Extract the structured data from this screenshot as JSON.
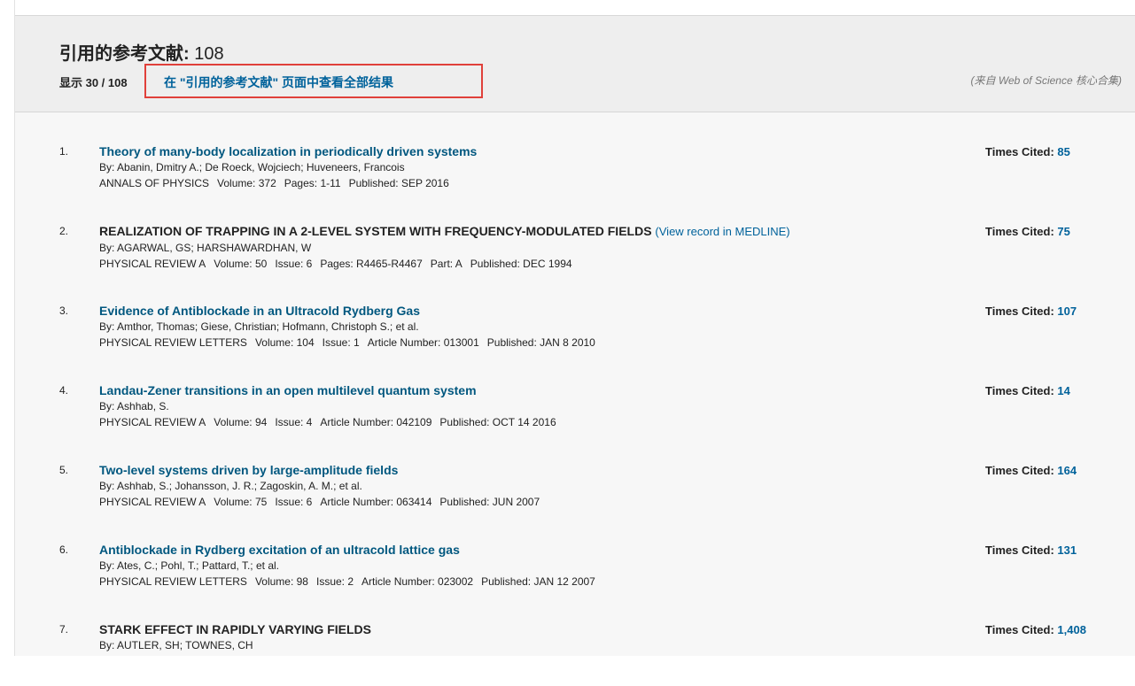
{
  "header": {
    "title": "引用的参考文献",
    "title_count": "108",
    "showing": "显示 30 / 108",
    "view_all_link": "在 \"引用的参考文献\" 页面中查看全部结果",
    "source_note": "(来自 Web of Science 核心合集)"
  },
  "labels": {
    "times_cited": "Times Cited:"
  },
  "records": [
    {
      "num": "1.",
      "title": "Theory of many-body localization in periodically driven systems",
      "authors": "By: Abanin, Dmitry A.; De Roeck, Wojciech; Huveneers, Francois",
      "journal": "ANNALS OF PHYSICS",
      "volume": "Volume: 372",
      "issue": "",
      "pages_or_article": "Pages: 1-11",
      "part": "",
      "published": "Published:  SEP 2016",
      "times_cited": "85"
    },
    {
      "num": "2.",
      "title": "REALIZATION OF TRAPPING IN A 2-LEVEL SYSTEM WITH FREQUENCY-MODULATED FIELDS",
      "medline": "(View record in MEDLINE)",
      "authors": "By: AGARWAL, GS; HARSHAWARDHAN, W",
      "journal": "PHYSICAL REVIEW A",
      "volume": "Volume: 50",
      "issue": "Issue: 6",
      "pages_or_article": "Pages:  R4465-R4467",
      "part": "Part:  A",
      "published": "Published:  DEC 1994",
      "times_cited": "75"
    },
    {
      "num": "3.",
      "title": "Evidence of Antiblockade in an Ultracold Rydberg Gas",
      "authors": "By: Amthor, Thomas; Giese, Christian; Hofmann, Christoph S.; et al.",
      "journal": "PHYSICAL REVIEW LETTERS",
      "volume": "Volume: 104",
      "issue": "Issue: 1",
      "pages_or_article": "Article Number: 013001",
      "part": "",
      "published": "Published:  JAN 8 2010",
      "times_cited": "107"
    },
    {
      "num": "4.",
      "title": "Landau-Zener transitions in an open multilevel quantum system",
      "authors": "By: Ashhab, S.",
      "journal": "PHYSICAL REVIEW A",
      "volume": "Volume: 94",
      "issue": "Issue: 4",
      "pages_or_article": "Article Number: 042109",
      "part": "",
      "published": "Published:  OCT 14 2016",
      "times_cited": "14"
    },
    {
      "num": "5.",
      "title": "Two-level systems driven by large-amplitude fields",
      "authors": "By: Ashhab, S.; Johansson, J. R.; Zagoskin, A. M.; et al.",
      "journal": "PHYSICAL REVIEW A",
      "volume": "Volume: 75",
      "issue": "Issue: 6",
      "pages_or_article": "Article Number: 063414",
      "part": "",
      "published": "Published:  JUN 2007",
      "times_cited": "164"
    },
    {
      "num": "6.",
      "title": "Antiblockade in Rydberg excitation of an ultracold lattice gas",
      "authors": "By: Ates, C.; Pohl, T.; Pattard, T.; et al.",
      "journal": "PHYSICAL REVIEW LETTERS",
      "volume": "Volume: 98",
      "issue": "Issue: 2",
      "pages_or_article": "Article Number: 023002",
      "part": "",
      "published": "Published:  JAN 12 2007",
      "times_cited": "131"
    },
    {
      "num": "7.",
      "title": "STARK EFFECT IN RAPIDLY VARYING FIELDS",
      "authors": "By: AUTLER, SH; TOWNES, CH",
      "journal": "",
      "volume": "",
      "issue": "",
      "pages_or_article": "",
      "part": "",
      "published": "",
      "times_cited": "1,408"
    }
  ]
}
